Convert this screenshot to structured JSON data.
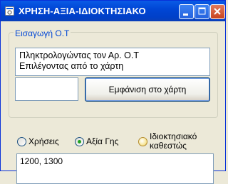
{
  "window": {
    "title": "ΧΡΗΣΗ-ΑΞΙΑ-ΙΔΙΟΚΤΗΣΙΑΚΟ",
    "controls": [
      "minimize-icon",
      "maximize-icon",
      "close-icon"
    ]
  },
  "group": {
    "legend": "Εισαγωγή Ο.Τ",
    "list_items": [
      "Πληκτρολογώντας τον Αρ. Ο.Τ",
      "Επιλέγοντας από το χάρτη"
    ],
    "input_value": "",
    "button_label": "Εμφάνιση στο χάρτη"
  },
  "options": [
    {
      "label": "Χρήσεις",
      "selected": false
    },
    {
      "label": "Αξία Γης",
      "selected": true
    },
    {
      "label": "Ιδιοκτησιακό καθεστώς",
      "selected": false
    }
  ],
  "results": {
    "items": [
      "1200, 1300"
    ]
  },
  "colors": {
    "titlebar": "#0046D5",
    "window_bg": "#ECE9D8",
    "legend_text": "#0046D5",
    "radio_checked": "#21A121"
  }
}
